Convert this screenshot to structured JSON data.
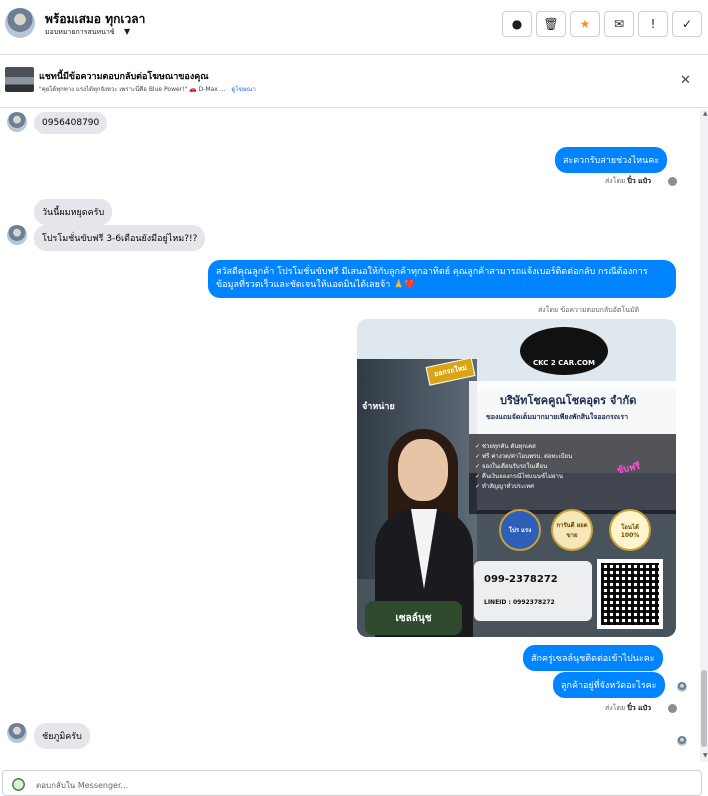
{
  "header": {
    "name": "พร้อมเสมอ ทุกเวลา",
    "subtitle": "มอบหมายการสนทนาซ้",
    "actions": [
      {
        "icon": "alert-circle-icon"
      },
      {
        "icon": "trash-icon"
      },
      {
        "icon": "star-icon"
      },
      {
        "icon": "mail-icon"
      },
      {
        "icon": "exclamation-icon"
      },
      {
        "icon": "checkmark-icon"
      }
    ]
  },
  "ad_reply": {
    "title": "แชทนี้มีข้อความตอบกลับต่อโฆษณาของคุณ",
    "subtitle": "\"คุยได้ทุกทาง แรงได้ทุกจังหวะ เพราะนี่คือ Blue Power!\" 🚗 D-Max ...",
    "link": "ดูโฆษณา"
  },
  "messages": [
    {
      "from": "customer",
      "text": "0956408790"
    },
    {
      "from": "page",
      "text": "สะดวกรับสายช่วงไหนคะ"
    },
    {
      "from": "meta",
      "prefix": "ส่งโดย",
      "sender": "ปิ๋ว แป๋ว"
    },
    {
      "from": "customer",
      "text": "วันนี้ผมหยุดครับ"
    },
    {
      "from": "customer",
      "text": "โปรโมชั่นขับฟรี 3-6เดือนยังมีอยู่ไหม?!?"
    },
    {
      "from": "page",
      "text": "สวัสดีคุณลูกค้า โปรโมชั่นขับฟรี มีเสนอให้กับลูกค้าทุกอาทิตย์ คุณลูกค้าสามารถแจ้งเบอร์ติดต่อกลับ กรณีต้องการข้อมูลที่รวดเร็วและชัดเจนให้แอดมินได้เลยจ้า 🙏❤️"
    },
    {
      "from": "meta",
      "prefix": "ส่งโดย",
      "sender": "ข้อความตอบกลับอัตโนมัติ"
    },
    {
      "from": "page",
      "text": "สักครู่เซลล์นุชติดต่อเข้าไปนะคะ"
    },
    {
      "from": "page",
      "text": "ลูกค้าอยู่ที่จังหวัดอะไรคะ"
    },
    {
      "from": "meta",
      "prefix": "ส่งโดย",
      "sender": "ปิ๋ว แป๋ว"
    },
    {
      "from": "customer",
      "text": "ชัยภูมิครับ"
    }
  ],
  "ad_image": {
    "badge": "ออกรถใหม่",
    "logo_text": "CKC 2 CAR.COM",
    "company": "บริษัทโชคคูณโชคอุดร จำกัด",
    "tagline": "ของแถมจัดเต็มมากมายเพียงพักสินใจออกรถเรา",
    "dealer": "จำหน่าย",
    "bullets": [
      "✓ ช่วยทุกคัน ดันทุกเคส",
      "✓ ฟรี ค่างวด/ค่าโอนพรบ. ต่อทะเบียน",
      "✓ จองในเดือนรับรถในเดือน",
      "✓ คืนเงินจองกรณีไฟแนนซ์ไม่ผ่าน",
      "✓ ทำสัญญาทั่วประเทศ"
    ],
    "promo": "ขับฟรี",
    "seals": [
      "โปร แรง",
      "การันตี ยอดขาย",
      "โอนได้ 100%"
    ],
    "phone": "099-2378272",
    "line_id": "LINEID : 0992378272",
    "name_tag": "เซลล์นุช"
  },
  "composer": {
    "placeholder": "ตอบกลับใน Messenger..."
  }
}
